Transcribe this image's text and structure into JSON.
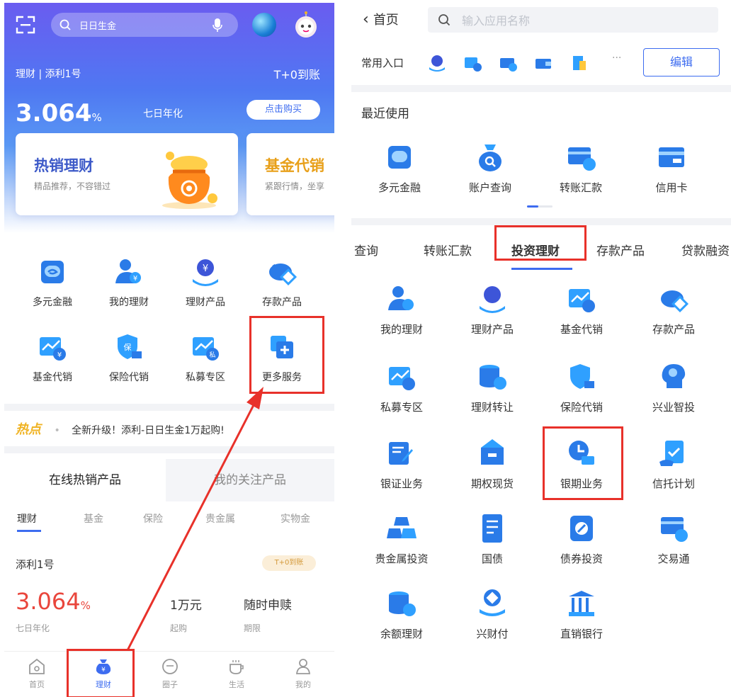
{
  "left": {
    "search_placeholder": "日日生金",
    "product_line": "理财 | 添利1号",
    "t0_label": "T+0到账",
    "rate_value": "3.064",
    "rate_unit": "%",
    "rate_label": "七日年化",
    "buy_button": "点击购买",
    "cards": [
      {
        "title": "热销理财",
        "subtitle": "精品推荐，不容错过"
      },
      {
        "title": "基金代销",
        "subtitle": "紧跟行情，坐享"
      }
    ],
    "grid": [
      "多元金融",
      "我的理财",
      "理财产品",
      "存款产品",
      "基金代销",
      "保险代销",
      "私募专区",
      "更多服务"
    ],
    "hot_label": "热点",
    "hot_bullet": "•",
    "hot_text": "全新升级！添利-日日生金1万起购!",
    "tab_hot": "在线热销产品",
    "tab_follow": "我的关注产品",
    "subtabs": [
      "理财",
      "基金",
      "保险",
      "贵金属",
      "实物金"
    ],
    "product_name": "添利1号",
    "product_tag": "T+0到账",
    "product_rate": "3.064",
    "product_rate_unit": "%",
    "product_rate_label": "七日年化",
    "min_value": "1万元",
    "min_label": "起购",
    "redeem_value": "随时申赎",
    "redeem_label": "期限",
    "nav": [
      "首页",
      "理财",
      "圈子",
      "生活",
      "我的"
    ]
  },
  "right": {
    "back_label": "首页",
    "search_placeholder": "输入应用名称",
    "common_label": "常用入口",
    "more_dots": "···",
    "edit_button": "编辑",
    "recent_title": "最近使用",
    "recent": [
      "多元金融",
      "账户查询",
      "转账汇款",
      "信用卡"
    ],
    "categories": [
      "查询",
      "转账汇款",
      "投资理财",
      "存款产品",
      "贷款融资"
    ],
    "services": [
      "我的理财",
      "理财产品",
      "基金代销",
      "存款产品",
      "私募专区",
      "理财转让",
      "保险代销",
      "兴业智投",
      "银证业务",
      "期权现货",
      "银期业务",
      "信托计划",
      "贵金属投资",
      "国债",
      "债券投资",
      "交易通",
      "余额理财",
      "兴财付",
      "直销银行"
    ]
  },
  "colors": {
    "brand_blue": "#3d6cf0",
    "highlight_red": "#e8312a",
    "accent_orange": "#f0b323",
    "rate_red": "#e9463c"
  }
}
